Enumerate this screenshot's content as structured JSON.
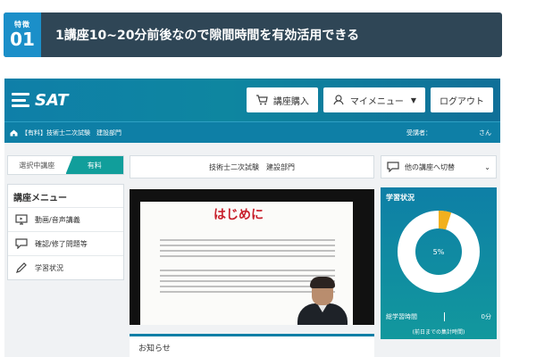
{
  "feature": {
    "badge_small": "特徴",
    "badge_number": "01",
    "headline": "1講座10~20分前後なので隙間時間を有効活用できる"
  },
  "app": {
    "logo": "SAT",
    "buttons": {
      "purchase": "講座購入",
      "my_menu": "マイメニュー",
      "logout": "ログアウト"
    },
    "breadcrumb": "【有料】技術士二次試験　建設部門",
    "student_label": "受講者：",
    "student_suffix": "さん",
    "tabs": [
      "選択中講座",
      "有料"
    ],
    "menu": {
      "title": "講座メニュー",
      "items": [
        "動画/音声講義",
        "確認/修了問題等",
        "学習状況"
      ]
    },
    "course_title": "技術士二次試験　建設部門",
    "slide_title": "はじめに",
    "notice_title": "お知らせ",
    "switch_label": "他の講座へ切替",
    "status": {
      "title": "学習状況",
      "percent_label": "5%",
      "percent_value": 5,
      "total_label": "総学習時間",
      "total_value": "0分",
      "note": "(前日までの集計時間)"
    },
    "colors": {
      "accent": "#0e7fa6",
      "teal": "#119e9b",
      "donut_fill": "#f2b01e",
      "donut_track": "#ffffff"
    }
  }
}
